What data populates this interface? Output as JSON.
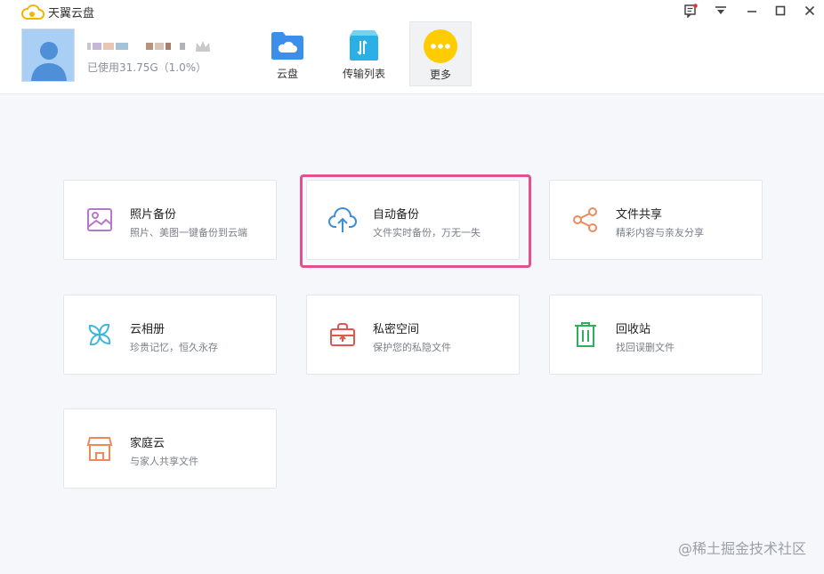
{
  "app": {
    "title": "天翼云盘"
  },
  "user": {
    "usage": "已使用31.75G（1.0%）"
  },
  "nav": [
    {
      "label": "云盘",
      "icon": "cloud-folder-icon"
    },
    {
      "label": "传输列表",
      "icon": "transfer-icon"
    },
    {
      "label": "更多",
      "icon": "more-icon"
    }
  ],
  "features": [
    {
      "title": "照片备份",
      "desc": "照片、美图一键备份到云端",
      "icon": "photo-icon",
      "color": "#b778c9"
    },
    {
      "title": "自动备份",
      "desc": "文件实时备份，万无一失",
      "icon": "cloud-upload-icon",
      "color": "#3a8fd6"
    },
    {
      "title": "文件共享",
      "desc": "精彩内容与亲友分享",
      "icon": "share-icon",
      "color": "#ee8a5a"
    },
    {
      "title": "云相册",
      "desc": "珍贵记忆，恒久永存",
      "icon": "pinwheel-icon",
      "color": "#3eb6d8"
    },
    {
      "title": "私密空间",
      "desc": "保护您的私隐文件",
      "icon": "lock-box-icon",
      "color": "#e2574c"
    },
    {
      "title": "回收站",
      "desc": "找回误删文件",
      "icon": "trash-icon",
      "color": "#2fae5f"
    },
    {
      "title": "家庭云",
      "desc": "与家人共享文件",
      "icon": "house-icon",
      "color": "#ee8a5a"
    }
  ],
  "watermark": "@稀土掘金技术社区"
}
